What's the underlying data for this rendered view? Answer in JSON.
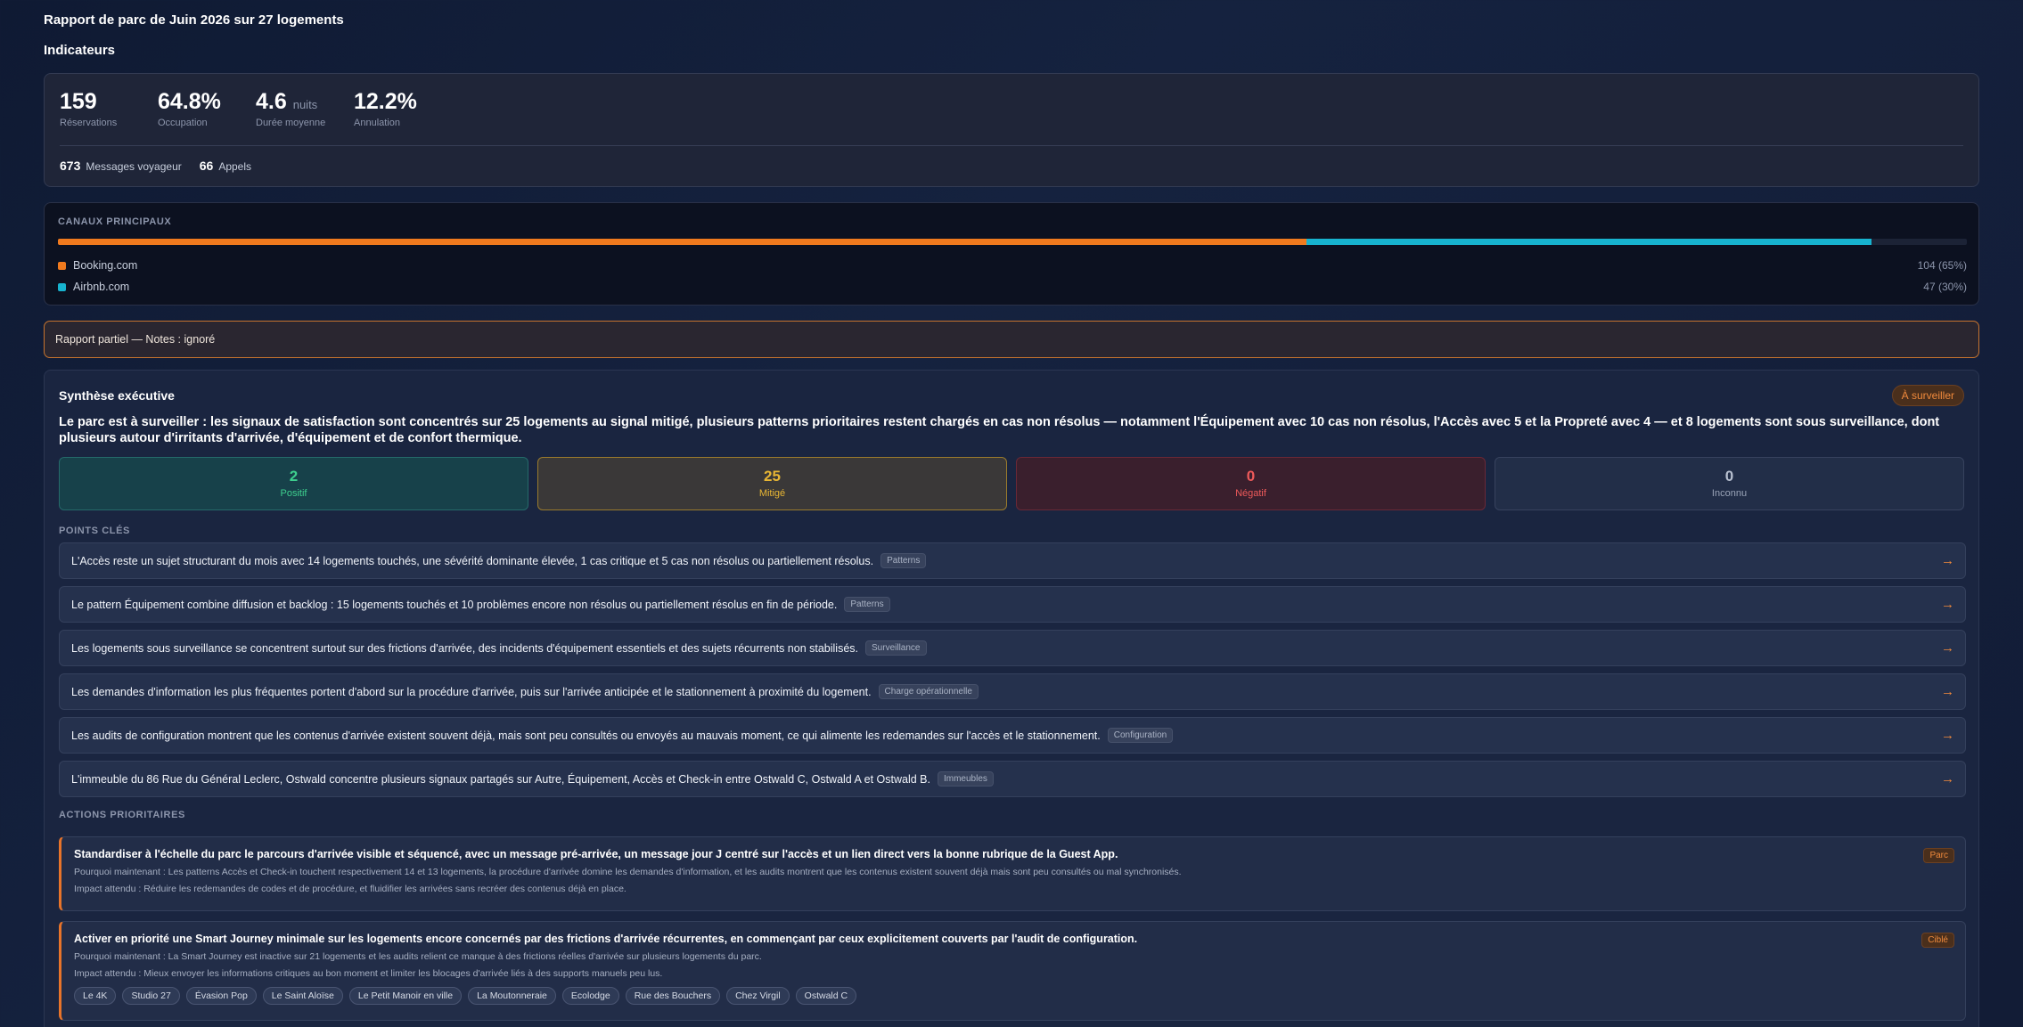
{
  "report_title": "Rapport de parc de Juin 2026 sur 27 logements",
  "indicators_title": "Indicateurs",
  "kpis": [
    {
      "value": "159",
      "unit": "",
      "label": "Réservations"
    },
    {
      "value": "64.8%",
      "unit": "",
      "label": "Occupation"
    },
    {
      "value": "4.6",
      "unit": "nuits",
      "label": "Durée moyenne"
    },
    {
      "value": "12.2%",
      "unit": "",
      "label": "Annulation"
    }
  ],
  "kpi_sub": [
    {
      "value": "673",
      "label": "Messages voyageur"
    },
    {
      "value": "66",
      "label": "Appels"
    }
  ],
  "channels": {
    "title": "CANAUX PRINCIPAUX",
    "items": [
      {
        "name": "Booking.com",
        "count": "104 (65%)",
        "share": 65.4,
        "color": "#f07a1e"
      },
      {
        "name": "Airbnb.com",
        "count": "47 (30%)",
        "share": 29.6,
        "color": "#17b3cf"
      }
    ]
  },
  "partial_banner": "Rapport partiel — Notes : ignoré",
  "synthesis": {
    "title": "Synthèse exécutive",
    "status_badge": "À surveiller",
    "summary": "Le parc est à surveiller : les signaux de satisfaction sont concentrés sur 25 logements au signal mitigé, plusieurs patterns prioritaires restent chargés en cas non résolus — notamment l'Équipement avec 10 cas non résolus, l'Accès avec 5 et la Propreté avec 4 — et 8 logements sont sous surveillance, dont plusieurs autour d'irritants d'arrivée, d'équipement et de confort thermique.",
    "sentiments": [
      {
        "value": "2",
        "label": "Positif"
      },
      {
        "value": "25",
        "label": "Mitigé"
      },
      {
        "value": "0",
        "label": "Négatif"
      },
      {
        "value": "0",
        "label": "Inconnu"
      }
    ],
    "key_points_title": "POINTS CLÉS",
    "key_points": [
      {
        "text": "L'Accès reste un sujet structurant du mois avec 14 logements touchés, une sévérité dominante élevée, 1 cas critique et 5 cas non résolus ou partiellement résolus.",
        "tag": "Patterns"
      },
      {
        "text": "Le pattern Équipement combine diffusion et backlog : 15 logements touchés et 10 problèmes encore non résolus ou partiellement résolus en fin de période.",
        "tag": "Patterns"
      },
      {
        "text": "Les logements sous surveillance se concentrent surtout sur des frictions d'arrivée, des incidents d'équipement essentiels et des sujets récurrents non stabilisés.",
        "tag": "Surveillance"
      },
      {
        "text": "Les demandes d'information les plus fréquentes portent d'abord sur la procédure d'arrivée, puis sur l'arrivée anticipée et le stationnement à proximité du logement.",
        "tag": "Charge opérationnelle"
      },
      {
        "text": "Les audits de configuration montrent que les contenus d'arrivée existent souvent déjà, mais sont peu consultés ou envoyés au mauvais moment, ce qui alimente les redemandes sur l'accès et le stationnement.",
        "tag": "Configuration"
      },
      {
        "text": "L'immeuble du 86 Rue du Général Leclerc, Ostwald concentre plusieurs signaux partagés sur Autre, Équipement, Accès et Check-in entre Ostwald C, Ostwald A et Ostwald B.",
        "tag": "Immeubles"
      }
    ],
    "actions_title": "ACTIONS PRIORITAIRES",
    "actions": [
      {
        "title": "Standardiser à l'échelle du parc le parcours d'arrivée visible et séquencé, avec un message pré-arrivée, un message jour J centré sur l'accès et un lien direct vers la bonne rubrique de la Guest App.",
        "why": "Pourquoi maintenant : Les patterns Accès et Check-in touchent respectivement 14 et 13 logements, la procédure d'arrivée domine les demandes d'information, et les audits montrent que les contenus existent souvent déjà mais sont peu consultés ou mal synchronisés.",
        "impact": "Impact attendu : Réduire les redemandes de codes et de procédure, et fluidifier les arrivées sans recréer des contenus déjà en place.",
        "badge": "Parc",
        "chips": []
      },
      {
        "title": "Activer en priorité une Smart Journey minimale sur les logements encore concernés par des frictions d'arrivée récurrentes, en commençant par ceux explicitement couverts par l'audit de configuration.",
        "why": "Pourquoi maintenant : La Smart Journey est inactive sur 21 logements et les audits relient ce manque à des frictions réelles d'arrivée sur plusieurs logements du parc.",
        "impact": "Impact attendu : Mieux envoyer les informations critiques au bon moment et limiter les blocages d'arrivée liés à des supports manuels peu lus.",
        "badge": "Ciblé",
        "chips": [
          "Le 4K",
          "Studio 27",
          "Évasion Pop",
          "Le Saint Aloïse",
          "Le Petit Manoir en ville",
          "La Moutonneraie",
          "Ecolodge",
          "Rue des Bouchers",
          "Chez Virgil",
          "Ostwald C"
        ]
      }
    ]
  }
}
